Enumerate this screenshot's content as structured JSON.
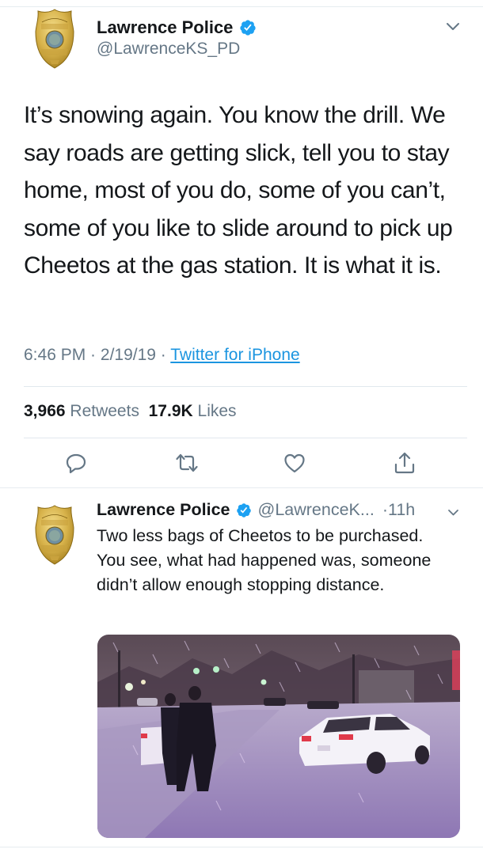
{
  "main_tweet": {
    "author_name": "Lawrence Police",
    "handle": "@LawrenceKS_PD",
    "text": "It’s snowing again. You know the drill. We say roads are getting slick, tell you to stay home, most of you do, some of you can’t, some of you like to slide around to pick up Cheetos at the gas station. It is what it is.",
    "time": "6:46 PM",
    "date": "2/19/19",
    "source": "Twitter for iPhone",
    "retweets_count": "3,966",
    "retweets_label": "Retweets",
    "likes_count": "17.9K",
    "likes_label": "Likes",
    "separator": " · "
  },
  "reply_tweet": {
    "author_name": "Lawrence Police",
    "handle": "@LawrenceK...",
    "age": "·11h",
    "text": "Two less bags of Cheetos to be purchased. You see, what had happened was, someone didn’t allow enough stopping distance."
  },
  "icons": {
    "verified": "verified-badge-icon",
    "caret": "chevron-down-icon",
    "reply": "reply-icon",
    "retweet": "retweet-icon",
    "like": "heart-icon",
    "share": "share-icon"
  },
  "colors": {
    "text": "#14171a",
    "secondary": "#657786",
    "link": "#1b95e0",
    "verified": "#1da1f2"
  }
}
